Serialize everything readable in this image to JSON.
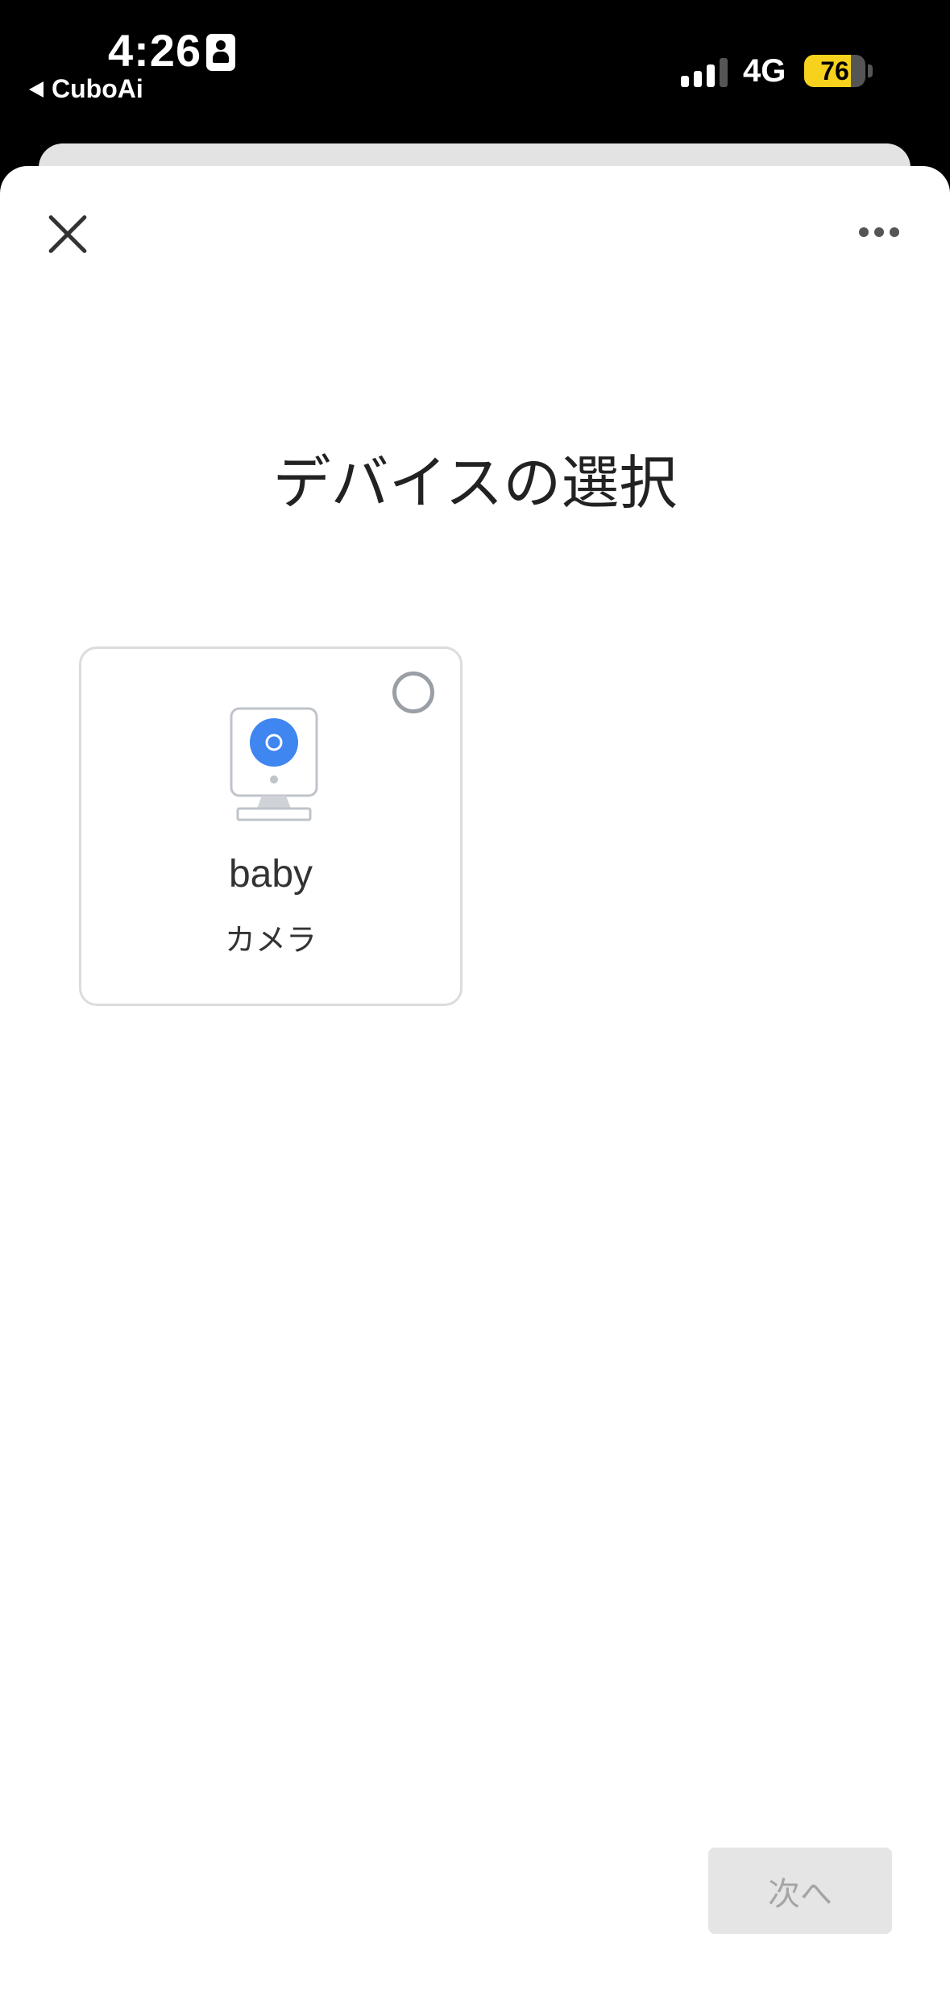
{
  "status_bar": {
    "time": "4:26",
    "back_app": "CuboAi",
    "network": "4G",
    "battery_percent": "76",
    "battery_level": 0.76,
    "signal_bars": 3
  },
  "header": {
    "close_icon": "close-icon",
    "more_icon": "more-horizontal-icon"
  },
  "main": {
    "title": "デバイスの選択",
    "devices": [
      {
        "name": "baby",
        "type": "カメラ",
        "icon": "camera-icon",
        "selected": false
      }
    ]
  },
  "footer": {
    "next_label": "次へ"
  },
  "colors": {
    "accent": "#3f86f0",
    "button_disabled_bg": "#e5e5e5",
    "button_disabled_text": "#a5a5a5"
  }
}
